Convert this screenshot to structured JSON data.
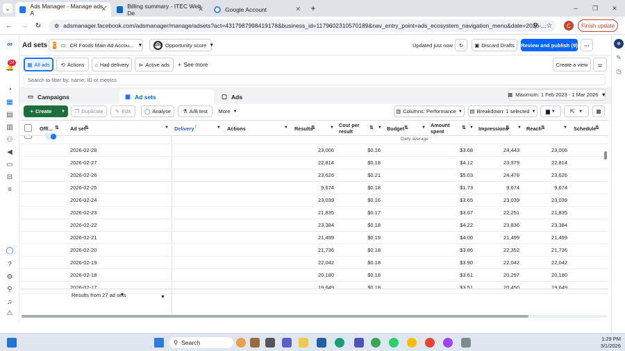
{
  "browser": {
    "tabs": [
      {
        "title": "Ads Manager - Manage ads - A",
        "color": "#1877f2"
      },
      {
        "title": "Billing summary - ITEC Web De",
        "color": "#0a66c2"
      },
      {
        "title": "Google Account",
        "color": "#4285f4"
      }
    ],
    "url": "adsmanager.facebook.com/adsmanager/manage/adsets?act=4317987998419178&business_id=1179602310570189&nav_entry_point=ads_ecosystem_navigation_menu&date=2026-...",
    "profile_letter": "C",
    "finish_update": "Finish update"
  },
  "topbar": {
    "title": "Ad sets",
    "account_badge": "C",
    "account_name": "CR Foods Main Ad Accou...",
    "opportunity_score": "Opportunity score",
    "opportunity_value": "100",
    "updated": "Updated just now",
    "discard": "Discard Drafts",
    "review": "Review and publish (9)",
    "notif_count": "24"
  },
  "filters": {
    "all_ads": "All ads",
    "actions": "Actions",
    "had_delivery": "Had delivery",
    "active_ads": "Active ads",
    "see_more": "See more",
    "create_view": "Create a view",
    "search_placeholder": "Search to filter by: name, ID or metrics"
  },
  "levels": {
    "campaigns": "Campaigns",
    "adsets": "Ad sets",
    "ads": "Ads",
    "date_range": "Maximum: 1 Feb 2023 - 1 Mar 2026"
  },
  "toolbar": {
    "create": "Create",
    "duplicate": "Duplicate",
    "edit": "Edit",
    "analyse": "Analyse",
    "ab_test": "A/B test",
    "more": "More",
    "columns": "Columns: Performance",
    "breakdown": "Breakdown: 1 selected"
  },
  "columns": {
    "off_on": "Off/...",
    "ad_set": "Ad set",
    "delivery": "Delivery",
    "actions": "Actions",
    "results": "Results",
    "cost_per_result": "Cost per result",
    "budget": "Budget",
    "amount_spent": "Amount spent",
    "impressions": "Impressions",
    "reach": "Reach",
    "schedule": "Schedule"
  },
  "daily_average": "Daily average",
  "rows": [
    {
      "date": "2026-02-28",
      "results": "23,006",
      "cpr": "$0.16",
      "spent": "$3.68",
      "impressions": "24,443",
      "reach": "23,006"
    },
    {
      "date": "2026-02-27",
      "results": "22,814",
      "cpr": "$0.18",
      "spent": "$4.12",
      "impressions": "23,979",
      "reach": "22,814"
    },
    {
      "date": "2026-02-26",
      "results": "23,626",
      "cpr": "$0.21",
      "spent": "$5.03",
      "impressions": "24,478",
      "reach": "23,626"
    },
    {
      "date": "2026-02-25",
      "results": "9,674",
      "cpr": "$0.18",
      "spent": "$1.73",
      "impressions": "9,674",
      "reach": "9,674"
    },
    {
      "date": "2026-02-24",
      "results": "23,039",
      "cpr": "$0.16",
      "spent": "$3.65",
      "impressions": "23,039",
      "reach": "23,039"
    },
    {
      "date": "2026-02-23",
      "results": "21,835",
      "cpr": "$0.17",
      "spent": "$3.67",
      "impressions": "22,251",
      "reach": "21,835"
    },
    {
      "date": "2026-02-22",
      "results": "23,384",
      "cpr": "$0.18",
      "spent": "$4.22",
      "impressions": "23,836",
      "reach": "23,384"
    },
    {
      "date": "2026-02-21",
      "results": "21,499",
      "cpr": "$0.19",
      "spent": "$4.00",
      "impressions": "21,499",
      "reach": "21,499"
    },
    {
      "date": "2026-02-20",
      "results": "21,736",
      "cpr": "$0.18",
      "spent": "$3.86",
      "impressions": "22,352",
      "reach": "21,736"
    },
    {
      "date": "2026-02-19",
      "results": "22,042",
      "cpr": "$0.18",
      "spent": "$3.90",
      "impressions": "22,042",
      "reach": "22,042"
    },
    {
      "date": "2026-02-18",
      "results": "20,180",
      "cpr": "$0.18",
      "spent": "$3.61",
      "impressions": "20,297",
      "reach": "20,180"
    },
    {
      "date": "2026-02-17",
      "results": "19,649",
      "cpr": "$0.18",
      "spent": "$3.51",
      "impressions": "20,450",
      "reach": "19,649"
    }
  ],
  "footer": {
    "results_from": "Results from 27 ad sets"
  },
  "taskbar": {
    "search": "Search",
    "time": "1:29 PM",
    "date": "3/1/2026"
  },
  "colors": {
    "brand_blue": "#0866ff",
    "create_green": "#1e6e3c",
    "accent": "#1877f2"
  }
}
